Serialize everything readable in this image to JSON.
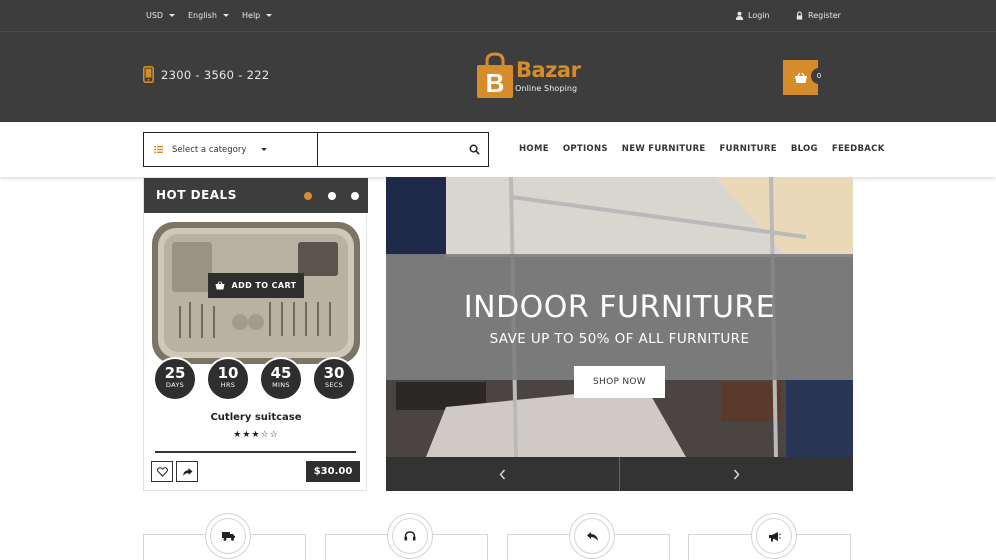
{
  "topbar": {
    "currency": "USD",
    "language": "English",
    "help": "Help",
    "login": "Login",
    "register": "Register"
  },
  "header": {
    "phone": "2300 - 3560 - 222",
    "logo_title": "Bazar",
    "logo_subtitle": "Online Shoping",
    "cart_count": "0",
    "accent_color": "#d68c2a",
    "bar_color": "#3d3d3d"
  },
  "search": {
    "category_label": "Select a category",
    "query": ""
  },
  "nav": {
    "items": [
      "HOME",
      "OPTIONS",
      "NEW FURNITURE",
      "FURNITURE",
      "BLOG",
      "FEEDBACK"
    ]
  },
  "hot_deals": {
    "title": "HOT DEALS",
    "add_to_cart": "ADD TO CART",
    "countdown": [
      {
        "value": "25",
        "unit": "DAYS"
      },
      {
        "value": "10",
        "unit": "HRS"
      },
      {
        "value": "45",
        "unit": "MINS"
      },
      {
        "value": "30",
        "unit": "SECS"
      }
    ],
    "product_name": "Cutlery suitcase",
    "rating": 3,
    "rating_max": 5,
    "price": "$30.00"
  },
  "banner": {
    "title": "INDOOR FURNITURE",
    "subtitle": "SAVE UP TO 50% OF ALL FURNITURE",
    "button": "SHOP NOW"
  },
  "features": {
    "icons": [
      "truck-icon",
      "headset-icon",
      "return-arrow-icon",
      "megaphone-icon"
    ]
  }
}
